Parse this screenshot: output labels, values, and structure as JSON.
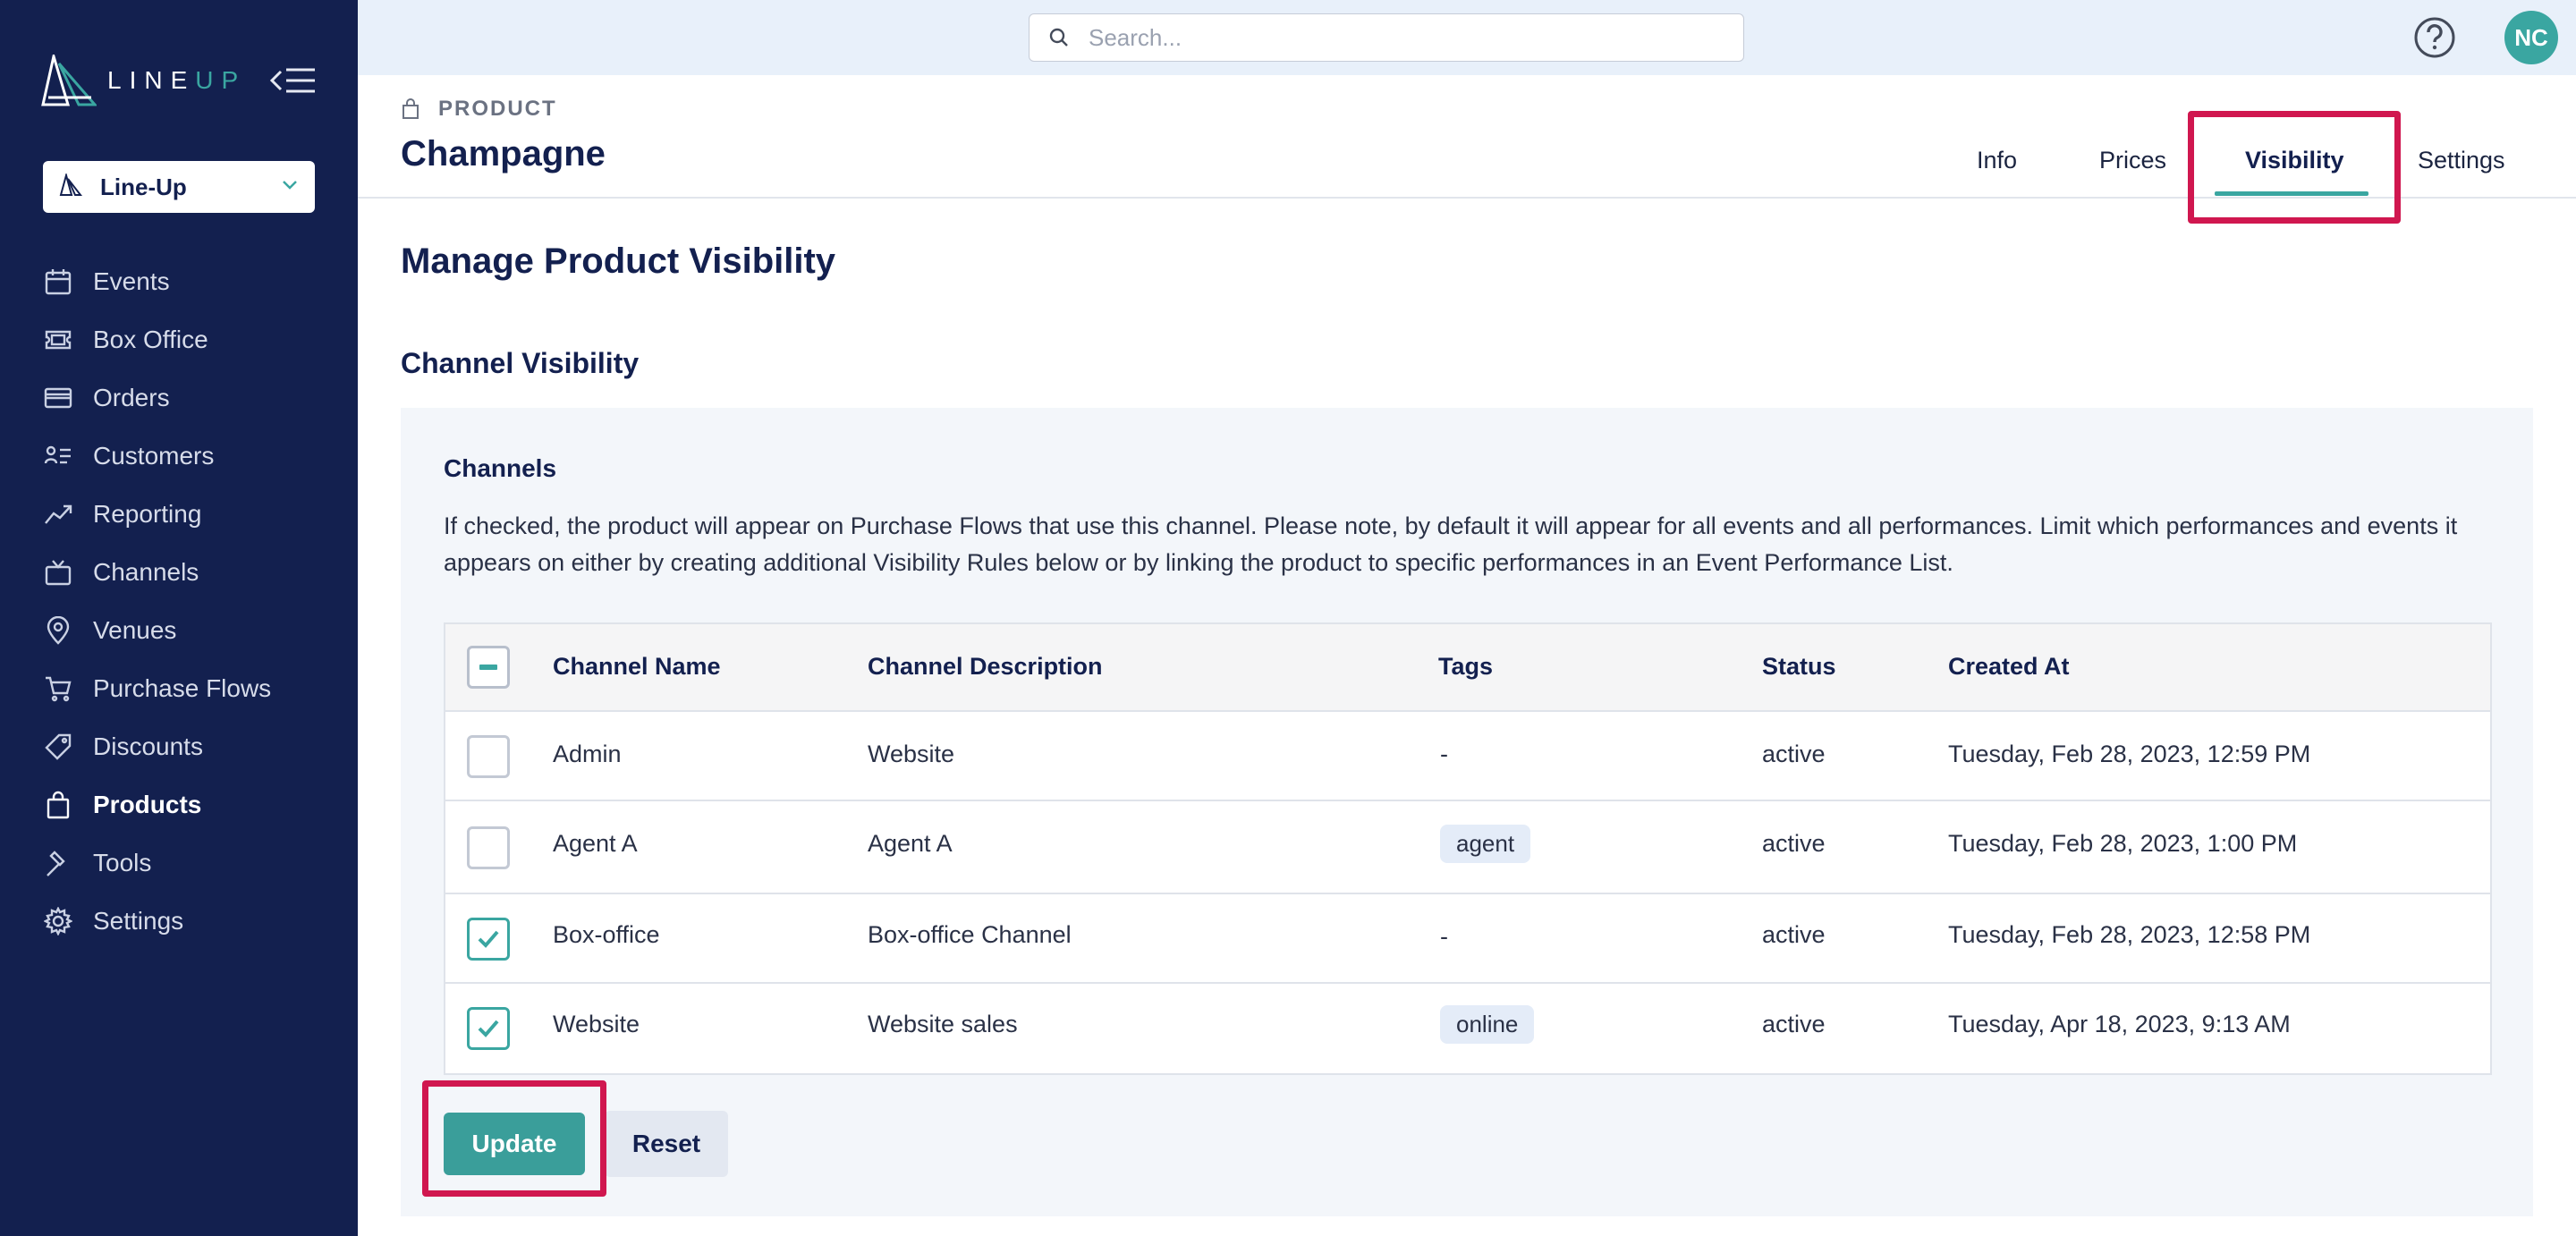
{
  "brand": {
    "logo_text_main": "LINE",
    "logo_text_accent": "UP",
    "accent_color": "#3aa6a1",
    "sidebar_color": "#13204f",
    "highlight_color": "#d0174f"
  },
  "org_selector": {
    "label": "Line-Up"
  },
  "sidebar": {
    "items": [
      {
        "label": "Events",
        "icon": "calendar-icon"
      },
      {
        "label": "Box Office",
        "icon": "ticket-icon"
      },
      {
        "label": "Orders",
        "icon": "credit-card-icon"
      },
      {
        "label": "Customers",
        "icon": "customers-icon"
      },
      {
        "label": "Reporting",
        "icon": "chart-line-icon"
      },
      {
        "label": "Channels",
        "icon": "tv-icon"
      },
      {
        "label": "Venues",
        "icon": "map-pin-icon"
      },
      {
        "label": "Purchase Flows",
        "icon": "cart-icon"
      },
      {
        "label": "Discounts",
        "icon": "tag-icon"
      },
      {
        "label": "Products",
        "icon": "shopping-bag-icon",
        "active": true
      },
      {
        "label": "Tools",
        "icon": "hammer-icon"
      },
      {
        "label": "Settings",
        "icon": "gear-icon"
      }
    ]
  },
  "topbar": {
    "search_placeholder": "Search...",
    "avatar_initials": "NC"
  },
  "header": {
    "breadcrumb": "PRODUCT",
    "title": "Champagne",
    "tabs": [
      {
        "label": "Info"
      },
      {
        "label": "Prices"
      },
      {
        "label": "Visibility",
        "active": true
      },
      {
        "label": "Settings"
      }
    ]
  },
  "main": {
    "title": "Manage Product Visibility",
    "section_title": "Channel Visibility",
    "channels_label": "Channels",
    "channels_description": "If checked, the product will appear on Purchase Flows that use this channel. Please note, by default it will appear for all events and all performances. Limit which performances and events it appears on either by creating additional Visibility Rules below or by linking the product to specific performances in an Event Performance List."
  },
  "table": {
    "columns": [
      "Channel Name",
      "Channel Description",
      "Tags",
      "Status",
      "Created At"
    ],
    "rows": [
      {
        "name": "Admin",
        "description": "Website",
        "tag": "",
        "tag_placeholder": "-",
        "status": "active",
        "created_at": "Tuesday, Feb 28, 2023, 12:59 PM",
        "checked": false
      },
      {
        "name": "Agent A",
        "description": "Agent A",
        "tag": "agent",
        "tag_placeholder": "",
        "status": "active",
        "created_at": "Tuesday, Feb 28, 2023, 1:00 PM",
        "checked": false
      },
      {
        "name": "Box-office",
        "description": "Box-office Channel",
        "tag": "",
        "tag_placeholder": "-",
        "status": "active",
        "created_at": "Tuesday, Feb 28, 2023, 12:58 PM",
        "checked": true
      },
      {
        "name": "Website",
        "description": "Website sales",
        "tag": "online",
        "tag_placeholder": "",
        "status": "active",
        "created_at": "Tuesday, Apr 18, 2023, 9:13 AM",
        "checked": true
      }
    ]
  },
  "actions": {
    "update_label": "Update",
    "reset_label": "Reset"
  }
}
